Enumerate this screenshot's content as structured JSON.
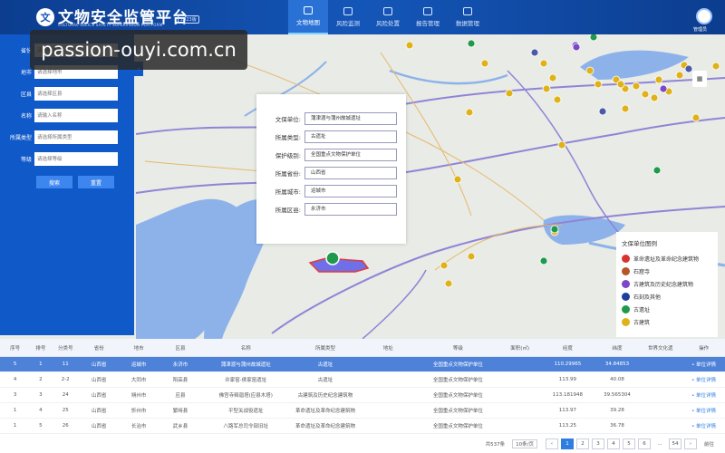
{
  "header": {
    "title": "文物安全监管平台",
    "subtitle": "CULTURAL RELICS SAFETY SUPERVISION PLATFORM",
    "version": "2023版",
    "nav": [
      {
        "label": "文物地图",
        "active": true
      },
      {
        "label": "风险监测",
        "active": false
      },
      {
        "label": "风险处置",
        "active": false
      },
      {
        "label": "报告管理",
        "active": false
      },
      {
        "label": "数据管理",
        "active": false
      }
    ],
    "user": "管理员"
  },
  "watermark": "passion-ouyi.com.cn",
  "filter": {
    "fields": [
      {
        "label": "省份",
        "placeholder": "请选择省份"
      },
      {
        "label": "地市",
        "placeholder": "请选择地市"
      },
      {
        "label": "区县",
        "placeholder": "请选择区县"
      },
      {
        "label": "名称",
        "placeholder": "请输入名称"
      },
      {
        "label": "所属类型",
        "placeholder": "请选择所属类型"
      },
      {
        "label": "等级",
        "placeholder": "请选择等级"
      }
    ],
    "search_label": "搜索",
    "reset_label": "重置",
    "collapse_icon": "‹"
  },
  "popup": {
    "rows": [
      {
        "label": "文保单位:",
        "value": "蒲津渡与蒲州故城遗址"
      },
      {
        "label": "所属类型:",
        "value": "古遗址"
      },
      {
        "label": "保护级别:",
        "value": "全国重点文物保护单位"
      },
      {
        "label": "所属省份:",
        "value": "山西省"
      },
      {
        "label": "所属城市:",
        "value": "运城市"
      },
      {
        "label": "所属区县:",
        "value": "永济市"
      }
    ]
  },
  "legend": {
    "title": "文保单位图例",
    "items": [
      {
        "label": "革命遗址及革命纪念建筑物",
        "color": "#d9342b"
      },
      {
        "label": "石窟寺",
        "color": "#b5562a"
      },
      {
        "label": "古建筑及历史纪念建筑物",
        "color": "#7a48c8"
      },
      {
        "label": "石刻及其他",
        "color": "#1e3f9e"
      },
      {
        "label": "古遗址",
        "color": "#1f9a4a"
      },
      {
        "label": "古建筑",
        "color": "#e0b21a"
      }
    ]
  },
  "table": {
    "headers": [
      "序号",
      "排号",
      "分类号",
      "省份",
      "地市",
      "区县",
      "名称",
      "所属类型",
      "地址",
      "等级",
      "面积(㎡)",
      "经度",
      "纬度",
      "世界文化遗",
      "操作"
    ],
    "rows": [
      [
        "5",
        "1",
        "11",
        "山西省",
        "运城市",
        "永济市",
        "蒲津渡与蒲州故城遗址",
        "古遗址",
        "",
        "全国重点文物保护单位",
        "",
        "110.29965",
        "34.84853",
        "",
        "• 单位详情"
      ],
      [
        "4",
        "2",
        "2-2",
        "山西省",
        "大同市",
        "阳高县",
        "许家窑-侯家窑遗址",
        "古遗址",
        "",
        "全国重点文物保护单位",
        "",
        "113.99",
        "40.08",
        "",
        "• 单位详情"
      ],
      [
        "3",
        "3",
        "24",
        "山西省",
        "朔州市",
        "应县",
        "佛宫寺释迦塔(应县木塔)",
        "古建筑及历史纪念建筑物",
        "",
        "全国重点文物保护单位",
        "",
        "113.181948",
        "39.565304",
        "",
        "• 单位详情"
      ],
      [
        "1",
        "4",
        "25",
        "山西省",
        "忻州市",
        "繁峙县",
        "平型关战役遗址",
        "革命遗址及革命纪念建筑物",
        "",
        "全国重点文物保护单位",
        "",
        "113.97",
        "39.28",
        "",
        "• 单位详情"
      ],
      [
        "1",
        "5",
        "26",
        "山西省",
        "长治市",
        "武乡县",
        "八路军总司令部旧址",
        "革命遗址及革命纪念建筑物",
        "",
        "全国重点文物保护单位",
        "",
        "113.25",
        "36.78",
        "",
        "• 单位详情"
      ]
    ],
    "selected_row": 0
  },
  "pager": {
    "total": "共537条",
    "page_size": "10条/页",
    "prev": "‹",
    "pages": [
      "1",
      "2",
      "3",
      "4",
      "5",
      "6",
      "...",
      "54"
    ],
    "next": "›",
    "goto": "前往"
  },
  "colors": {
    "header": "#0c3d8f",
    "panel": "#0f59c9",
    "selected_row": "#4e82d9"
  }
}
